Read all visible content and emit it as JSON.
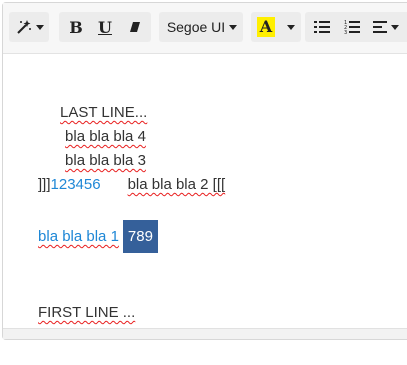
{
  "toolbar": {
    "font_name": "Segoe UI",
    "font_color_glyph": "A",
    "bold_glyph": "B",
    "underline_glyph": "U",
    "highlight_color": "#ffef00"
  },
  "content": {
    "line1": "LAST LINE...",
    "line2": "bla bla bla 4",
    "line3": "bla bla bla 3",
    "line4_brackets": "]]]",
    "line4_number": "123456",
    "line4_text": "bla bla bla 2 [[[",
    "line5_text": "bla bla bla 1",
    "line5_selected": "789",
    "line6": "FIRST LINE ..."
  }
}
